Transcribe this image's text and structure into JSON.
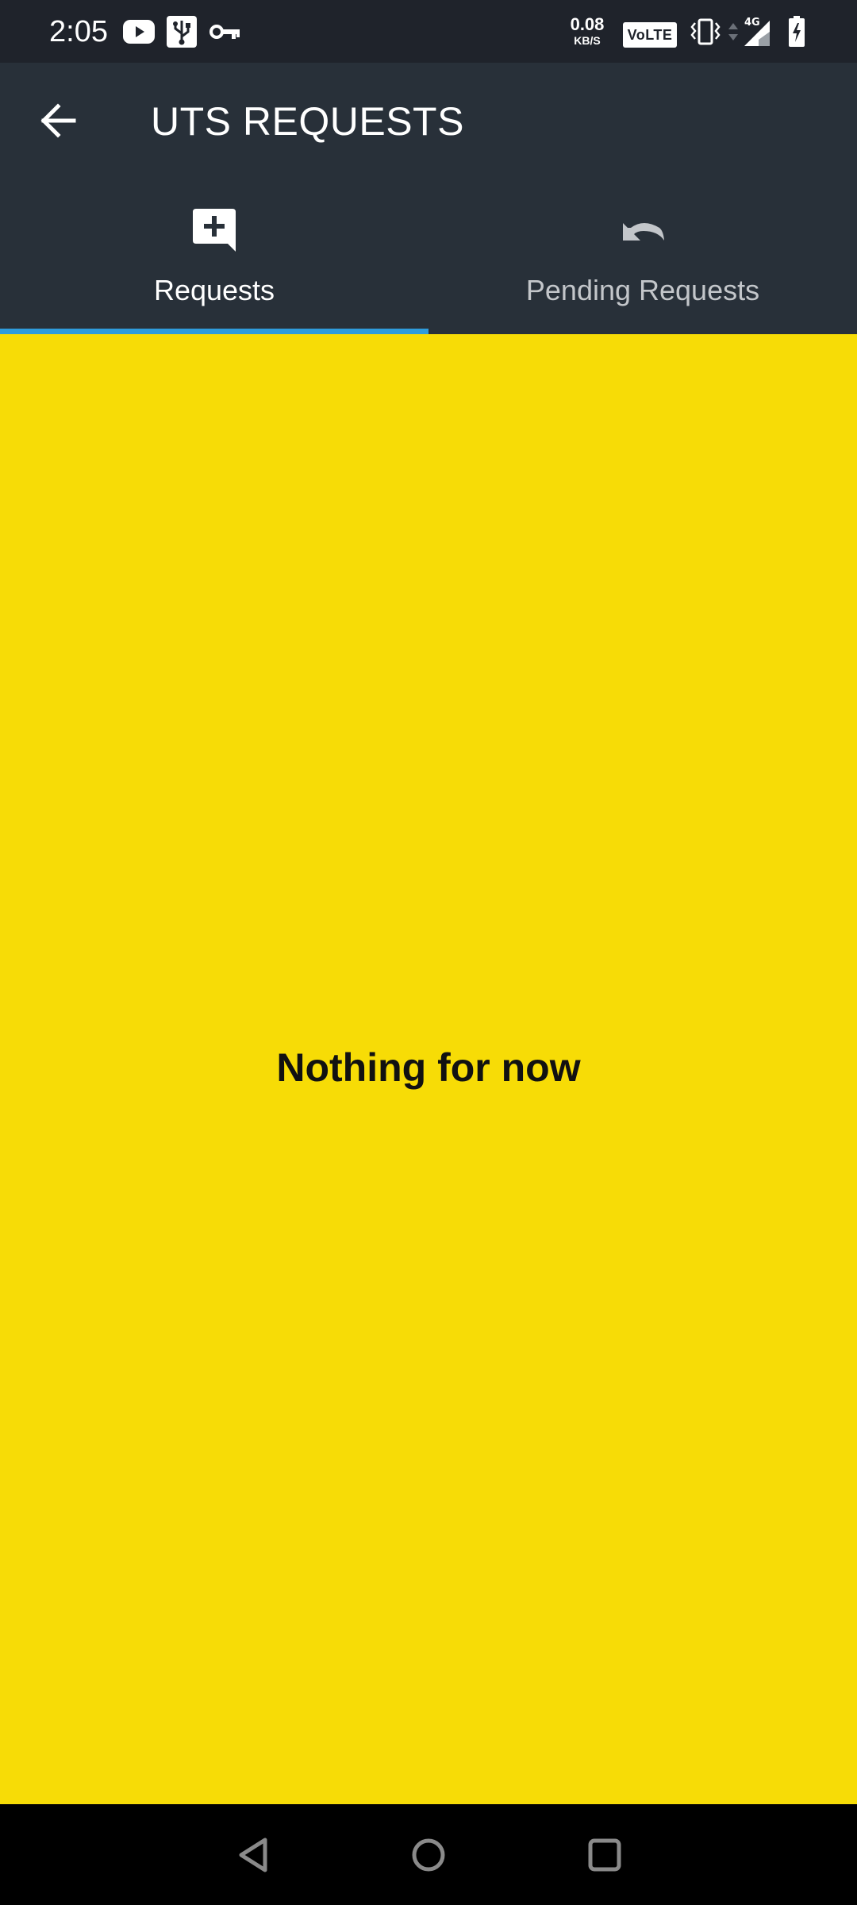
{
  "status_bar": {
    "time": "2:05",
    "net_speed_value": "0.08",
    "net_speed_unit": "KB/S",
    "volte": "VoLTE",
    "network_type": "4G",
    "icons": [
      "youtube-icon",
      "usb-icon",
      "vpn-key-icon",
      "vibrate-icon",
      "data-arrows-icon",
      "signal-icon",
      "battery-charging-icon"
    ]
  },
  "app_bar": {
    "title": "UTS REQUESTS",
    "back_icon": "arrow-back-icon"
  },
  "tabs": [
    {
      "label": "Requests",
      "icon": "add-comment-icon",
      "selected": true
    },
    {
      "label": "Pending Requests",
      "icon": "undo-icon",
      "selected": false
    }
  ],
  "main": {
    "empty_message": "Nothing for now"
  },
  "nav_bar": {
    "buttons": [
      "back-triangle-icon",
      "home-circle-icon",
      "recents-square-icon"
    ]
  },
  "colors": {
    "status_bar_bg": "#1f232b",
    "app_bar_bg": "#283039",
    "accent_indicator": "#2f9cdc",
    "content_bg": "#f7dc06",
    "tab_active_text": "#ffffff",
    "tab_inactive_text": "#c3c6ca"
  }
}
